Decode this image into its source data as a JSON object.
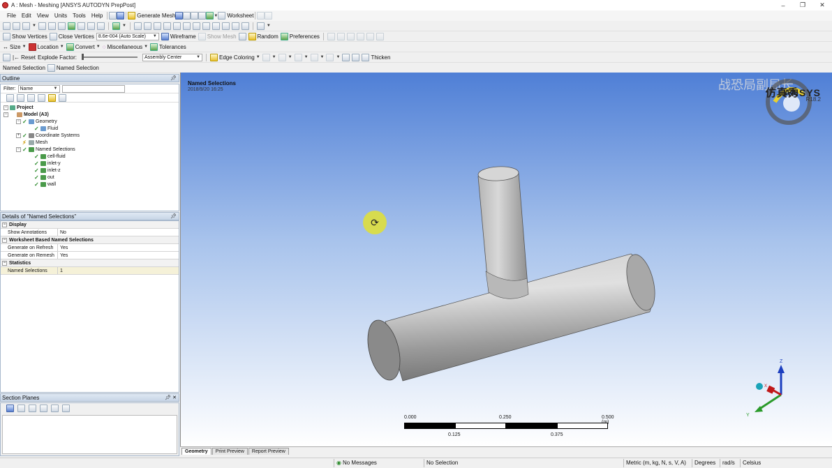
{
  "window": {
    "title": "A : Mesh - Meshing [ANSYS AUTODYN PrepPost]",
    "ctrl_min": "–",
    "ctrl_max": "❐",
    "ctrl_close": "✕"
  },
  "menu": [
    "File",
    "Edit",
    "View",
    "Units",
    "Tools",
    "Help"
  ],
  "toolbar1": {
    "generate_mesh": "Generate Mesh",
    "worksheet": "Worksheet"
  },
  "toolbar2": {
    "show_vertices": "Show Vertices",
    "close_vertices": "Close Vertices",
    "auto_scale": "8.6e-004 (Auto Scale)",
    "wireframe": "Wireframe",
    "show_mesh": "Show Mesh",
    "random": "Random",
    "preferences": "Preferences"
  },
  "toolbar3": {
    "size": "Size",
    "location": "Location",
    "convert": "Convert",
    "miscellaneous": "Miscellaneous",
    "tolerances": "Tolerances"
  },
  "toolbar4": {
    "reset": "Reset",
    "explode_factor": "Explode Factor:",
    "assembly_center": "Assembly Center",
    "edge_coloring": "Edge Coloring",
    "thicken": "Thicken"
  },
  "toolbar5": {
    "named_selection_label": "Named Selection",
    "named_selection_button": "Named Selection"
  },
  "outline": {
    "header": "Outline",
    "filter_label": "Filter:",
    "filter_value": "Name",
    "tree": [
      {
        "label": "Project",
        "bold": true,
        "level": 0
      },
      {
        "label": "Model (A3)",
        "bold": true,
        "level": 1
      },
      {
        "label": "Geometry",
        "level": 2
      },
      {
        "label": "Fluid",
        "level": 3
      },
      {
        "label": "Coordinate Systems",
        "level": 2
      },
      {
        "label": "Mesh",
        "level": 2
      },
      {
        "label": "Named Selections",
        "level": 2
      },
      {
        "label": "cell-fluid",
        "level": 3
      },
      {
        "label": "inlet-y",
        "level": 3
      },
      {
        "label": "inlet-z",
        "level": 3
      },
      {
        "label": "out",
        "level": 3
      },
      {
        "label": "wall",
        "level": 3
      }
    ]
  },
  "details": {
    "header": "Details of \"Named Selections\"",
    "rows": [
      {
        "type": "section",
        "key": "Display"
      },
      {
        "key": "Show Annotations",
        "value": "No"
      },
      {
        "type": "section",
        "key": "Worksheet Based Named Selections"
      },
      {
        "key": "Generate on Refresh",
        "value": "Yes"
      },
      {
        "key": "Generate on Remesh",
        "value": "Yes"
      },
      {
        "type": "section",
        "key": "Statistics"
      },
      {
        "key": "Named Selections",
        "value": "1",
        "highlight": true
      }
    ]
  },
  "section_planes": {
    "header": "Section Planes"
  },
  "viewport": {
    "title": "Named Selections",
    "date": "2018/9/20 16:25",
    "brand": "ANSYS",
    "version": "R18.2",
    "watermark_cn": "仿真秀",
    "watermark_cn2": "战恐局副局长",
    "scale_labels_top": [
      "0.000",
      "0.250",
      "0.500 (m)"
    ],
    "scale_labels_bottom": [
      "0.125",
      "0.375"
    ],
    "axis_z": "Z",
    "axis_y": "Y",
    "axis_x": "X"
  },
  "tabs": [
    "Geometry",
    "Print Preview",
    "Report Preview"
  ],
  "status": {
    "messages": "No Messages",
    "selection": "No Selection",
    "units": "Metric (m, kg, N, s, V, A)",
    "angle": "Degrees",
    "rate": "rad/s",
    "temp": "Celsius"
  }
}
